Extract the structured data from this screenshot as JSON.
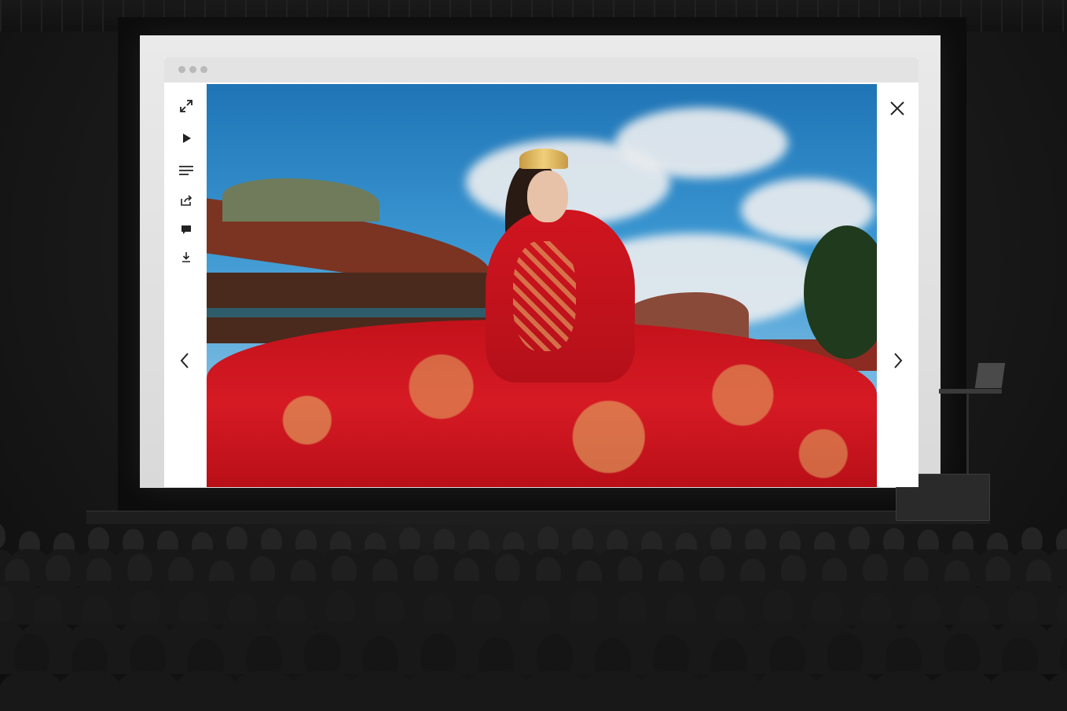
{
  "scene": "auditorium-projection",
  "browser": {
    "window_dots": [
      "close",
      "minimize",
      "maximize"
    ]
  },
  "toolbar": {
    "items": [
      {
        "icon": "fullscreen-icon"
      },
      {
        "icon": "play-icon"
      },
      {
        "icon": "menu-lines-icon"
      },
      {
        "icon": "share-icon"
      },
      {
        "icon": "comment-icon"
      },
      {
        "icon": "download-icon"
      }
    ]
  },
  "viewer": {
    "prev_icon": "chevron-left-icon",
    "next_icon": "chevron-right-icon",
    "close_icon": "close-icon"
  },
  "colors": {
    "dress_red": "#d61a24",
    "gold": "#e4ba6a",
    "sky_blue": "#2d86c4",
    "toolbar_icon": "#222222",
    "titlebar": "#e3e3e3"
  }
}
